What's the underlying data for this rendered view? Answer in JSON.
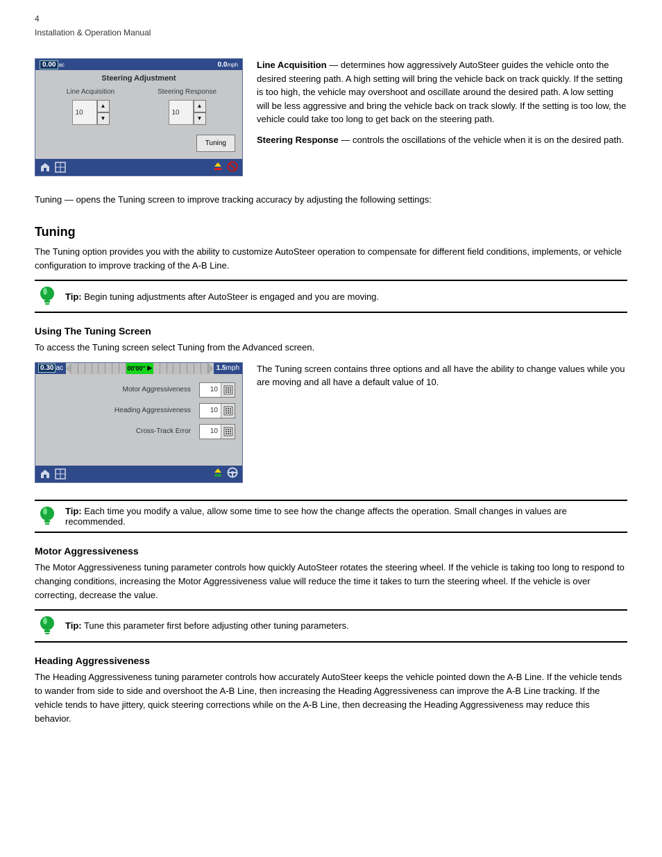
{
  "page": {
    "number": "4",
    "breadcrumb": "Installation & Operation Manual"
  },
  "panel1": {
    "acres": "0.00",
    "acres_unit": "ac",
    "speed": "0.0",
    "speed_unit": "mph",
    "title": "Steering Adjustment",
    "line_acq_label": "Line Acquisition",
    "line_acq_value": "10",
    "steer_resp_label": "Steering Response",
    "steer_resp_value": "10",
    "tuning_label": "Tuning"
  },
  "text1": {
    "p1_lead": "Line Acquisition",
    "p1_body": " — determines how aggressively AutoSteer guides the vehicle onto the desired steering path. A high setting will bring the vehicle back on track quickly. If the setting is too high, the vehicle may overshoot and oscillate around the desired path. A low setting will be less aggressive and bring the vehicle back on track slowly. If the setting is too low, the vehicle could take too long to get back on the steering path.",
    "p2_lead": "Steering Response",
    "p2_body": " — controls the oscillations of the vehicle when it is on the desired path."
  },
  "para_tuning": "Tuning — opens the Tuning screen to improve tracking accuracy by adjusting the following settings:",
  "heading_tuning": "Tuning",
  "tuning_intro": "The Tuning option provides you with the ability to customize AutoSteer operation to compensate for different field conditions, implements, or vehicle configuration to improve tracking of the A-B Line.",
  "tip1": {
    "label": "Tip:",
    "body": " Begin tuning adjustments after AutoSteer is engaged and you are moving."
  },
  "heading_using": "Using The Tuning Screen",
  "using_intro": "To access the Tuning screen select Tuning from the Advanced screen.",
  "panel2": {
    "acres": "0.30",
    "acres_unit": "ac",
    "lightbar_center": "00'00\"",
    "speed": "1.5",
    "speed_unit": "mph",
    "rows": [
      {
        "label": "Motor Aggressiveness",
        "value": "10"
      },
      {
        "label": "Heading Aggressiveness",
        "value": "10"
      },
      {
        "label": "Cross-Track Error",
        "value": "10"
      }
    ]
  },
  "text2": "The Tuning screen contains three options and all have the ability to change values while you are moving and all have a default value of 10.",
  "tip2": {
    "label": "Tip:",
    "body": " Each time you modify a value, allow some time to see how the change affects the operation. Small changes in values are recommended."
  },
  "motor_heading": "Motor Aggressiveness",
  "motor_body": "The Motor Aggressiveness tuning parameter controls how quickly AutoSteer rotates the steering wheel. If the vehicle is taking too long to respond to changing conditions, increasing the Motor Aggressiveness value will reduce the time it takes to turn the steering wheel. If the vehicle is over correcting, decrease the value.",
  "tip3": {
    "label": "Tip:",
    "body": " Tune this parameter first before adjusting other tuning parameters."
  },
  "heading_heading": "Heading Aggressiveness",
  "heading_body": "The Heading Aggressiveness tuning parameter controls how accurately AutoSteer keeps the vehicle pointed down the A-B Line. If the vehicle tends to wander from side to side and overshoot the A-B Line, then increasing the Heading Aggressiveness can improve the A-B Line tracking. If the vehicle tends to have jittery, quick steering corrections while on the A-B Line, then decreasing the Heading Aggressiveness may reduce this behavior.",
  "colors": {
    "bulb_green": "#16a83a"
  }
}
